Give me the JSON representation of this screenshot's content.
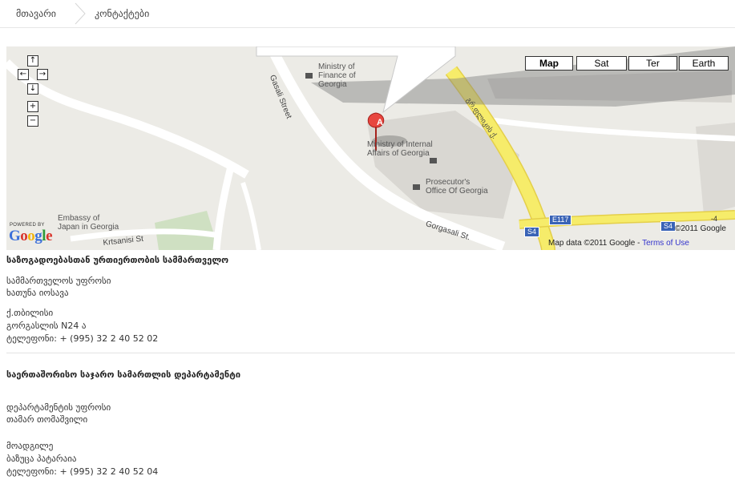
{
  "breadcrumb": {
    "home": "მთავარი",
    "current": "კონტაქტები"
  },
  "map": {
    "map_types": [
      "Map",
      "Sat",
      "Ter",
      "Earth"
    ],
    "active_map_type": "Map",
    "nav_icons": [
      "pan-up-icon",
      "pan-left-icon",
      "pan-right-icon",
      "pan-down-icon",
      "zoom-in-icon",
      "zoom-out-icon"
    ],
    "marker_letter": "A",
    "places": {
      "finance": [
        "Ministry of",
        "Finance of",
        "Georgia"
      ],
      "internal": [
        "Ministry of Internal",
        "Affairs of Georgia"
      ],
      "prosecutor": [
        "Prosecutor's",
        "Office Of Georgia"
      ],
      "embassy": [
        "Embassy of",
        "Japan in Georgia"
      ]
    },
    "streets": {
      "gasali": "Gasali Street",
      "gorgasali": "Gorgasali St.",
      "krtsanisi": "Krtsanisi St",
      "georgian": "გრ.ფლიკის ქ."
    },
    "shields": [
      "E117",
      "S4",
      "S4",
      "-4"
    ],
    "powered_by": "POWERED BY",
    "google_letters": [
      "G",
      "o",
      "o",
      "g",
      "l",
      "e"
    ],
    "copyright": "©2011 Google",
    "map_data": "Map data ©2011 Google - ",
    "terms": "Terms of Use"
  },
  "section1": {
    "title": "საზოგადოებასთან ურთიერთობის სამმართველო",
    "head_role": "სამმართველოს უფროსი",
    "head_name": "ხათუნა იოსავა",
    "city": "ქ.თბილისი",
    "address": "გორგასლის N24 ა",
    "phone": "ტელეფონი: + (995) 32 2 40 52 02"
  },
  "section2": {
    "title": "საერთაშორისო საჯარო სამართლის დეპარტამენტი",
    "head_role": "დეპარტამენტის უფროსი",
    "head_name": "თამარ თომაშვილი",
    "deputy_role": "მოადგილე",
    "deputy_name": "ბაზუცა პატარაია",
    "phone": "ტელეფონი: + (995) 32 2 40 52 04"
  }
}
